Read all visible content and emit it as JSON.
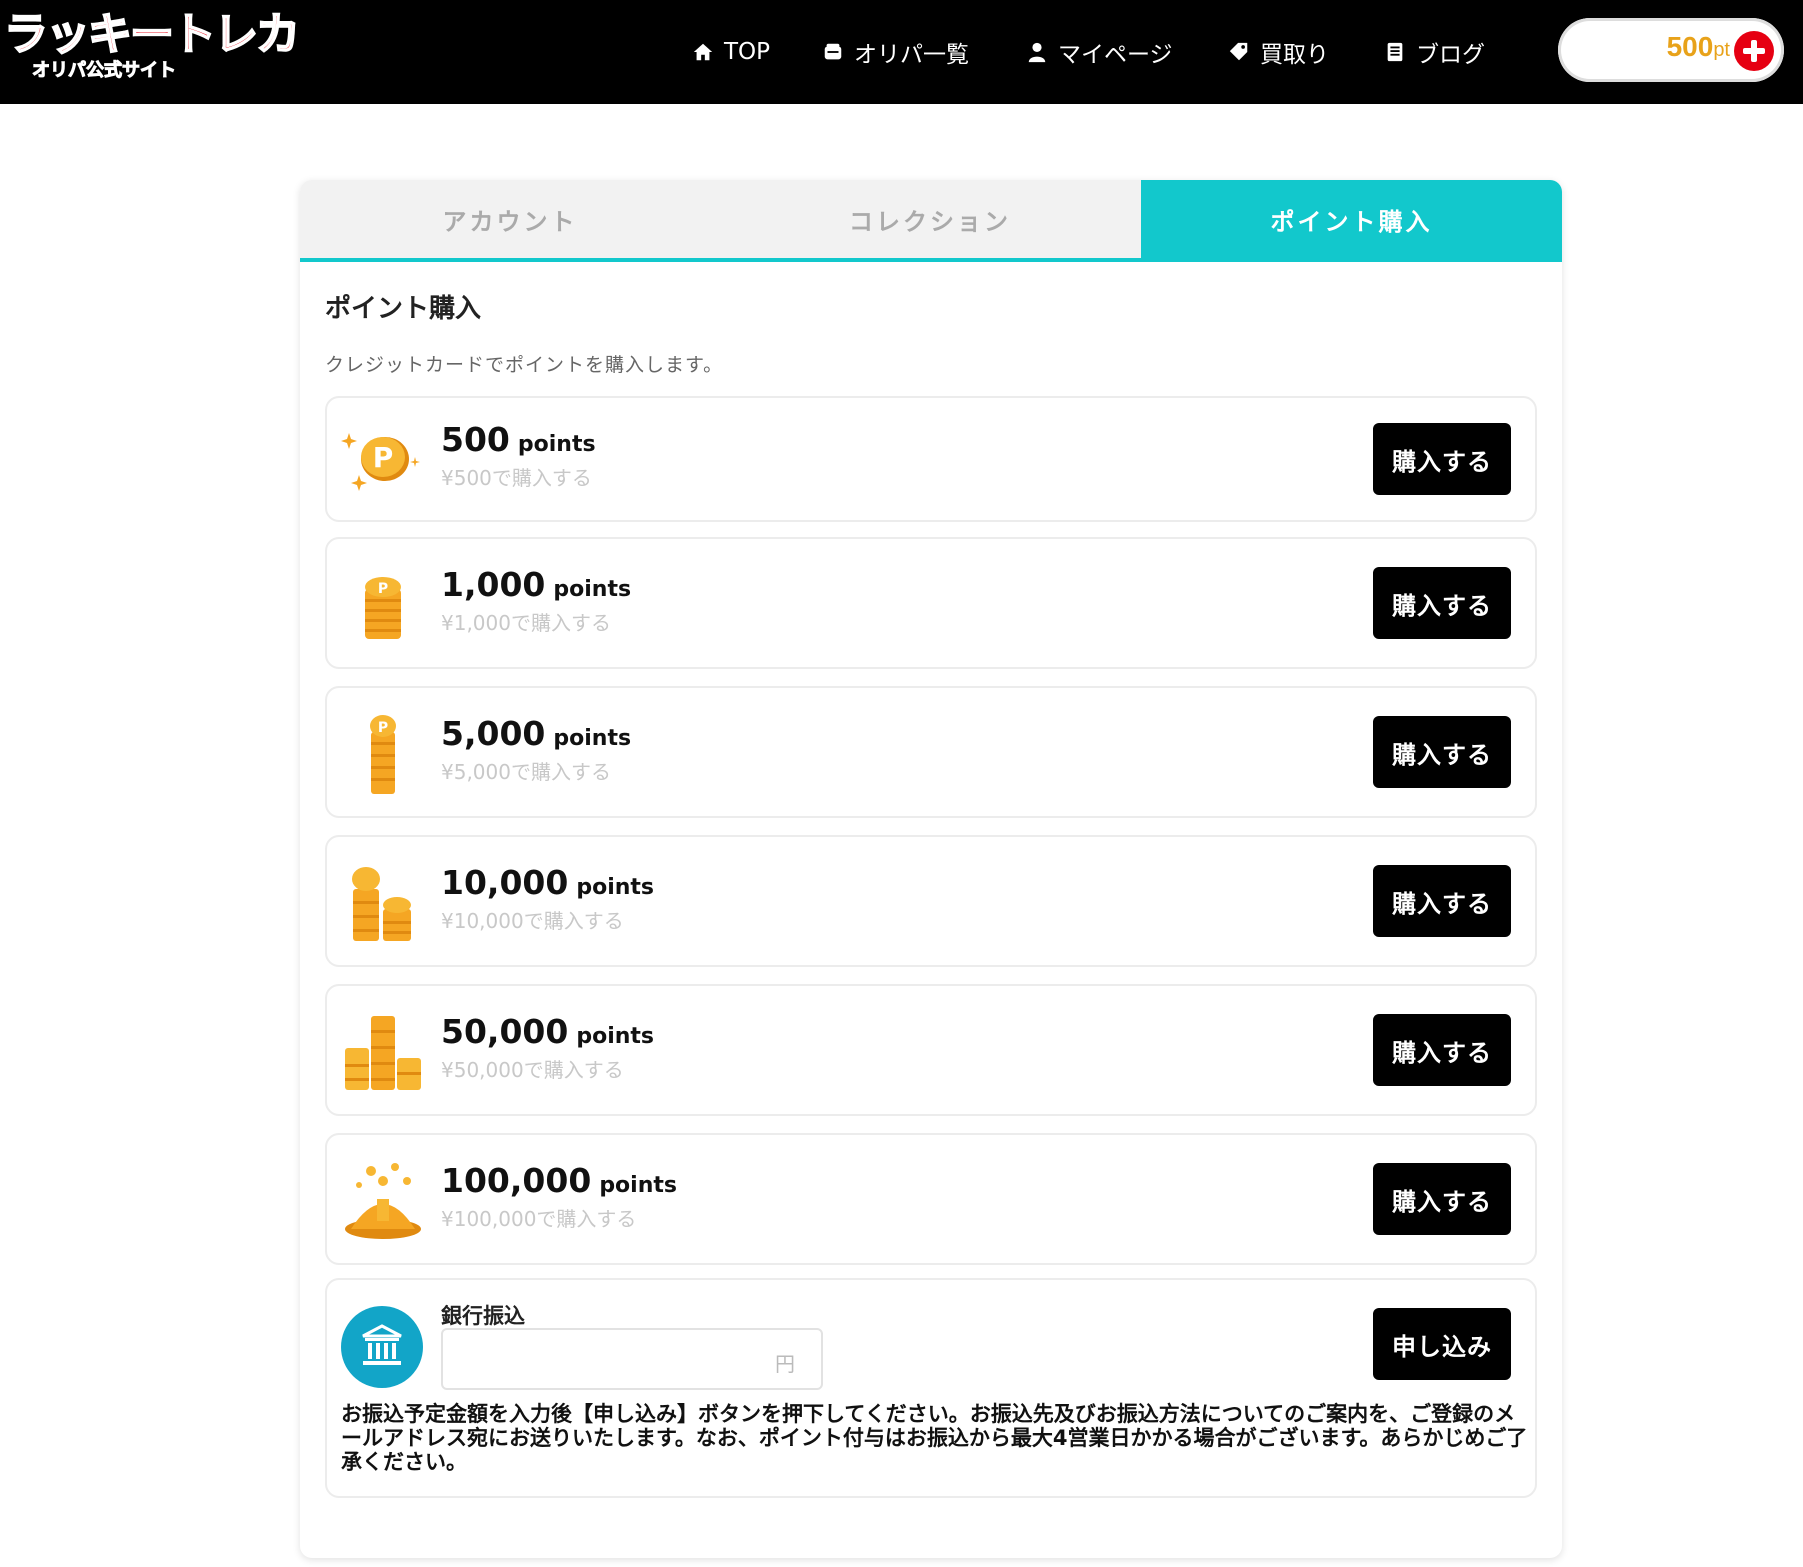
{
  "header": {
    "logo_line1": "ラッキートレカ",
    "logo_line2": "オリパ公式サイト",
    "nav": {
      "top": "TOP",
      "oripa": "オリパ一覧",
      "mypage": "マイページ",
      "kaitori": "買取り",
      "blog": "ブログ"
    },
    "points_value": "500",
    "points_unit": "pt"
  },
  "tabs": {
    "account": "アカウント",
    "collection": "コレクション",
    "points": "ポイント購入"
  },
  "section": {
    "title": "ポイント購入",
    "description": "クレジットカードでポイントを購入します。"
  },
  "packages": [
    {
      "amount": "500",
      "unit": "points",
      "price": "¥500で購入する",
      "button": "購入する"
    },
    {
      "amount": "1,000",
      "unit": "points",
      "price": "¥1,000で購入する",
      "button": "購入する"
    },
    {
      "amount": "5,000",
      "unit": "points",
      "price": "¥5,000で購入する",
      "button": "購入する"
    },
    {
      "amount": "10,000",
      "unit": "points",
      "price": "¥10,000で購入する",
      "button": "購入する"
    },
    {
      "amount": "50,000",
      "unit": "points",
      "price": "¥50,000で購入する",
      "button": "購入する"
    },
    {
      "amount": "100,000",
      "unit": "points",
      "price": "¥100,000で購入する",
      "button": "購入する"
    }
  ],
  "bank": {
    "label": "銀行振込",
    "input_value": "",
    "input_unit": "円",
    "button": "申し込み",
    "notice": "お振込予定金額を入力後【申し込み】ボタンを押下してください。お振込先及びお振込方法についてのご案内を、ご登録のメールアドレス宛にお送りいたします。なお、ポイント付与はお振込から最大4営業日かかる場合がございます。あらかじめご了承ください。"
  },
  "colors": {
    "accent": "#12c8cc",
    "header_bg": "#000000",
    "points_gold": "#e8a21a",
    "plus_red": "#e60012",
    "coin_gold": "#f5a623"
  }
}
